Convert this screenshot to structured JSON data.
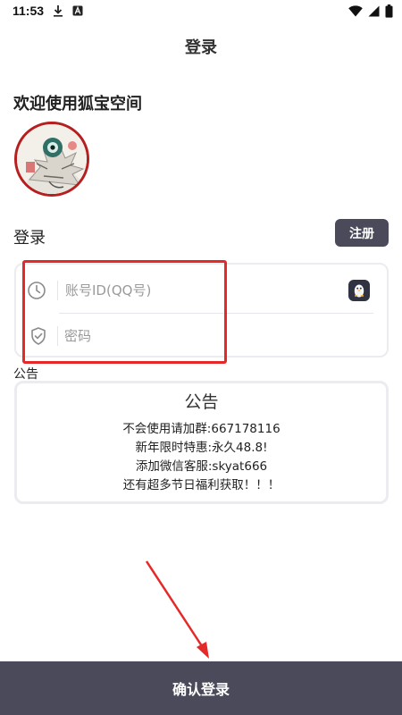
{
  "status_bar": {
    "time": "11:53"
  },
  "app_bar": {
    "title": "登录"
  },
  "welcome": "欢迎使用狐宝空间",
  "login": {
    "label": "登录",
    "register_label": "注册",
    "account_placeholder": "账号ID(QQ号)",
    "password_placeholder": "密码"
  },
  "notice": {
    "label": "公告",
    "title": "公告",
    "lines": [
      "不会使用请加群:667178116",
      "新年限时特惠:永久48.8!",
      "添加微信客服:skyat666",
      "还有超多节日福利获取！！！"
    ]
  },
  "confirm_label": "确认登录",
  "icons": {
    "status_left": [
      "download-icon",
      "notification-a-icon"
    ],
    "status_right": [
      "wifi-icon",
      "signal-icon",
      "battery-icon"
    ],
    "fields": [
      "clock-icon",
      "shield-check-icon",
      "qq-penguin-icon"
    ]
  },
  "colors": {
    "button": "#4a4a5a",
    "highlight": "#e52828",
    "avatar_border": "#b51f1f"
  }
}
